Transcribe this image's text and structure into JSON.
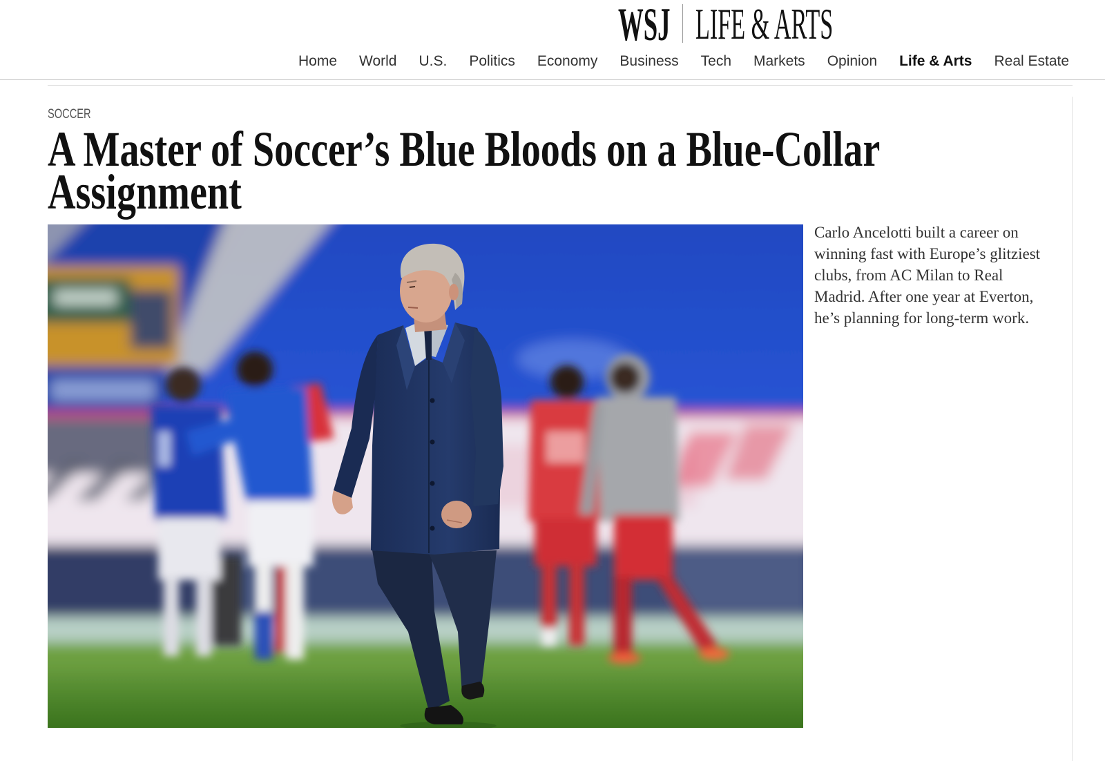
{
  "brand": {
    "logo": "WSJ",
    "section": "LIFE & ARTS"
  },
  "nav": {
    "items": [
      {
        "label": "Home"
      },
      {
        "label": "World"
      },
      {
        "label": "U.S."
      },
      {
        "label": "Politics"
      },
      {
        "label": "Economy"
      },
      {
        "label": "Business"
      },
      {
        "label": "Tech"
      },
      {
        "label": "Markets"
      },
      {
        "label": "Opinion"
      },
      {
        "label": "Life & Arts",
        "active": true
      },
      {
        "label": "Real Estate"
      }
    ]
  },
  "article": {
    "category": "SOCCER",
    "headline": "A Master of Soccer’s Blue Bloods on a Blue-Collar Assignment",
    "summary": "Carlo Ancelotti built a career on winning fast with Europe’s glitziest clubs, from AC Milan to Real Madrid. After one year at Everton, he’s planning for long-term work."
  },
  "colors": {
    "text": "#111111",
    "nav_text": "#333333",
    "category": "#555555",
    "summary": "#333333",
    "rule": "#cccccc"
  }
}
